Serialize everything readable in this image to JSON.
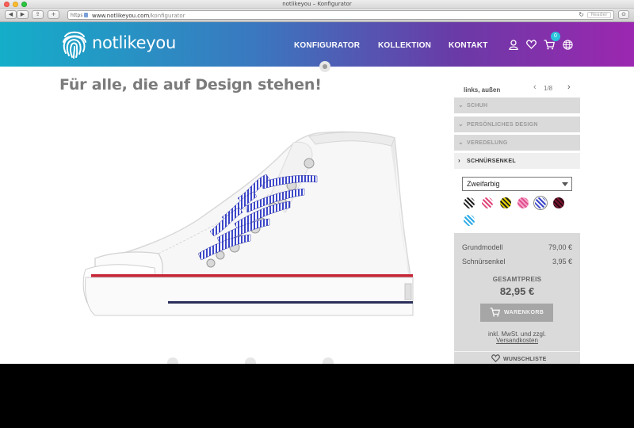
{
  "window": {
    "title": "notlikeyou – Konfigurator"
  },
  "toolbar": {
    "back": "◀",
    "forward": "▶",
    "share": "⇪",
    "new_tab": "+",
    "url_scheme": "https",
    "url_host": "www.notlikeyou.com",
    "url_path": "/konfigurator",
    "reload": "↻",
    "reader": "Reader",
    "downloads": "⊙"
  },
  "header": {
    "logo_text": "notlikeyou",
    "nav": [
      "KONFIGURATOR",
      "KOLLEKTION",
      "KONTAKT"
    ],
    "cart_count": "0",
    "icons": [
      "user-icon",
      "heart-icon",
      "cart-icon",
      "globe-icon"
    ]
  },
  "main": {
    "headline": "Für alle, die auf Design stehen!"
  },
  "panel": {
    "side_name": "links, außen",
    "pager": {
      "prev": "‹",
      "label": "1/8",
      "next": "›"
    },
    "sections": [
      {
        "label": "SCHUH",
        "active": false
      },
      {
        "label": "PERSÖNLICHES DESIGN",
        "active": false
      },
      {
        "label": "VEREDELUNG",
        "active": false
      },
      {
        "label": "SCHNÜRSENKEL",
        "active": true
      }
    ],
    "lace_select": "Zweifarbig",
    "swatches": [
      {
        "name": "black-white",
        "c1": "#222222",
        "c2": "#ffffff",
        "selected": false
      },
      {
        "name": "pink-white",
        "c1": "#e0457b",
        "c2": "#ffffff",
        "selected": false
      },
      {
        "name": "yellow-black",
        "c1": "#e6d300",
        "c2": "#222222",
        "selected": false
      },
      {
        "name": "pink",
        "c1": "#e05090",
        "c2": "#f6a7c8",
        "selected": false
      },
      {
        "name": "blue-white",
        "c1": "#3b46c8",
        "c2": "#ffffff",
        "selected": true
      },
      {
        "name": "burgundy-black",
        "c1": "#7a1430",
        "c2": "#2b0a12",
        "selected": false
      },
      {
        "name": "cyan-white",
        "c1": "#2aa9e6",
        "c2": "#ffffff",
        "selected": false
      }
    ],
    "price": {
      "rows": [
        {
          "label": "Grundmodell",
          "value": "79,00 €"
        },
        {
          "label": "Schnürsenkel",
          "value": "3,95 €"
        }
      ],
      "total_label": "GESAMTPREIS",
      "total_value": "82,95 €",
      "cart_button": "WARENKORB",
      "tax_note_1": "inkl. MwSt. und zzgl.",
      "tax_note_2": "Versandkosten",
      "wishlist": "WUNSCHLISTE"
    }
  }
}
